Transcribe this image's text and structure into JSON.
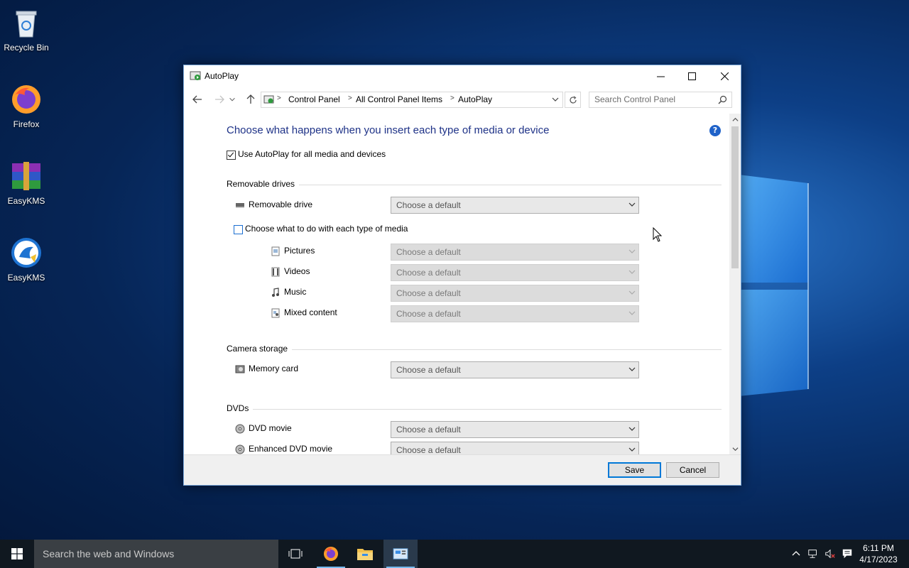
{
  "desktop": {
    "icons": [
      {
        "label": "Recycle Bin"
      },
      {
        "label": "Firefox"
      },
      {
        "label": "EasyKMS"
      },
      {
        "label": "EasyKMS"
      }
    ]
  },
  "window": {
    "title": "AutoPlay",
    "breadcrumb": [
      "Control Panel",
      "All Control Panel Items",
      "AutoPlay"
    ],
    "search_placeholder": "Search Control Panel",
    "heading": "Choose what happens when you insert each type of media or device",
    "use_autoplay": {
      "label": "Use AutoPlay for all media and devices",
      "checked": true
    },
    "sections": {
      "removable": {
        "title": "Removable drives",
        "drive_label": "Removable drive",
        "each_type": {
          "label": "Choose what to do with each type of media",
          "checked": false
        },
        "media": [
          {
            "label": "Pictures",
            "icon": "pictures-icon"
          },
          {
            "label": "Videos",
            "icon": "videos-icon"
          },
          {
            "label": "Music",
            "icon": "music-icon"
          },
          {
            "label": "Mixed content",
            "icon": "mixed-content-icon"
          }
        ]
      },
      "camera": {
        "title": "Camera storage",
        "memory_card": "Memory card"
      },
      "dvds": {
        "title": "DVDs",
        "dvd_movie": "DVD movie",
        "enhanced_dvd_movie": "Enhanced DVD movie"
      }
    },
    "select_default": "Choose a default",
    "buttons": {
      "save": "Save",
      "cancel": "Cancel"
    }
  },
  "taskbar": {
    "search_placeholder": "Search the web and Windows",
    "time": "6:11 PM",
    "date": "4/17/2023"
  },
  "colors": {
    "heading": "#1e3287",
    "accent": "#0078d7",
    "taskbar": "#101820"
  }
}
